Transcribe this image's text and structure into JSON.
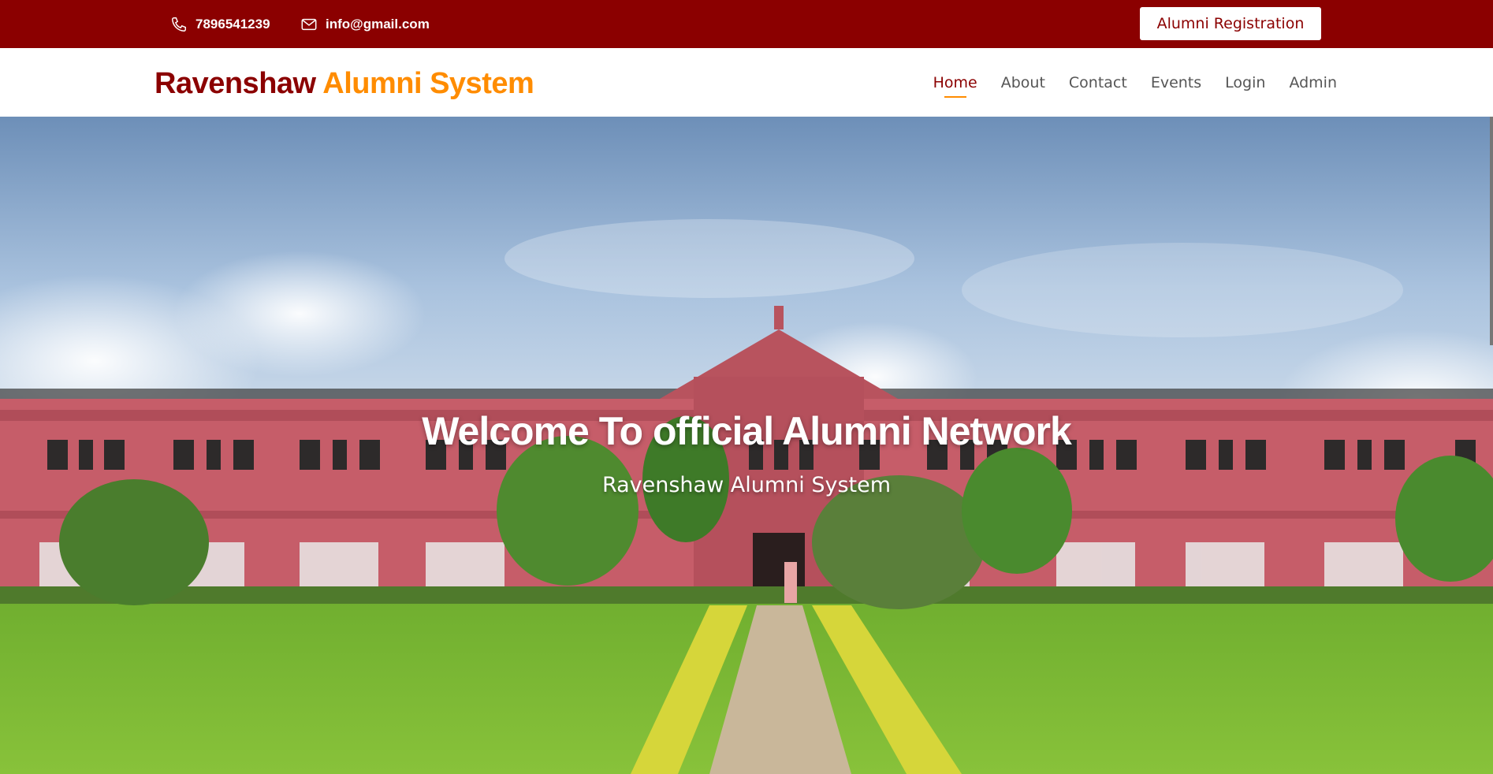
{
  "topbar": {
    "phone": "7896541239",
    "email": "info@gmail.com",
    "registration_button": "Alumni Registration",
    "phone_icon": "phone-icon",
    "email_icon": "envelope-icon"
  },
  "brand": {
    "part1": "Ravenshaw",
    "part2": "Alumni System"
  },
  "nav": {
    "items": [
      {
        "label": "Home",
        "active": true
      },
      {
        "label": "About"
      },
      {
        "label": "Contact"
      },
      {
        "label": "Events"
      },
      {
        "label": "Login"
      },
      {
        "label": "Admin"
      }
    ]
  },
  "hero": {
    "title": "Welcome To official Alumni Network",
    "subtitle": "Ravenshaw Alumni System"
  },
  "colors": {
    "primary": "#8b0000",
    "accent": "#ff8c00"
  }
}
